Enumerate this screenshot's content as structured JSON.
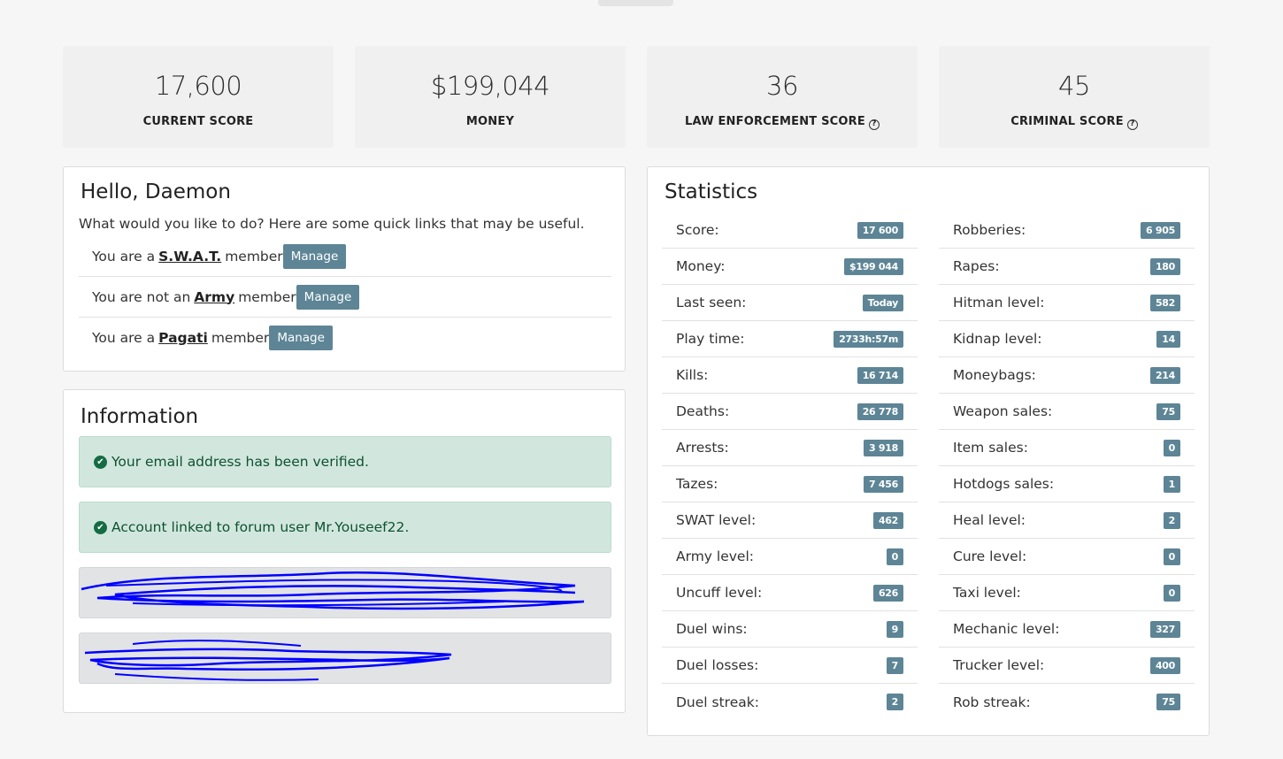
{
  "score_cards": [
    {
      "value": "17,600",
      "label": "CURRENT SCORE",
      "help": false
    },
    {
      "value": "$199,044",
      "label": "MONEY",
      "help": false
    },
    {
      "value": "36",
      "label": "LAW ENFORCEMENT SCORE",
      "help": true
    },
    {
      "value": "45",
      "label": "CRIMINAL SCORE",
      "help": true
    }
  ],
  "hello": {
    "title": "Hello, Daemon",
    "intro": "What would you like to do? Here are some quick links that may be useful.",
    "memberships": [
      {
        "prefix": "You are a",
        "group": "S.W.A.T.",
        "suffix": "member",
        "button": "Manage"
      },
      {
        "prefix": "You are not an",
        "group": "Army",
        "suffix": "member",
        "button": "Manage"
      },
      {
        "prefix": "You are a",
        "group": "Pagati",
        "suffix": "member",
        "button": "Manage"
      }
    ]
  },
  "information": {
    "title": "Information",
    "alerts": [
      {
        "text": "Your email address has been verified.",
        "type": "success"
      },
      {
        "text": "Account linked to forum user Mr.Youseef22.",
        "type": "success"
      }
    ]
  },
  "statistics": {
    "title": "Statistics",
    "left": [
      {
        "label": "Score:",
        "value": "17 600"
      },
      {
        "label": "Money:",
        "value": "$199 044"
      },
      {
        "label": "Last seen:",
        "value": "Today"
      },
      {
        "label": "Play time:",
        "value": "2733h:57m"
      },
      {
        "label": "Kills:",
        "value": "16 714"
      },
      {
        "label": "Deaths:",
        "value": "26 778"
      },
      {
        "label": "Arrests:",
        "value": "3 918"
      },
      {
        "label": "Tazes:",
        "value": "7 456"
      },
      {
        "label": "SWAT level:",
        "value": "462"
      },
      {
        "label": "Army level:",
        "value": "0"
      },
      {
        "label": "Uncuff level:",
        "value": "626"
      },
      {
        "label": "Duel wins:",
        "value": "9"
      },
      {
        "label": "Duel losses:",
        "value": "7"
      },
      {
        "label": "Duel streak:",
        "value": "2"
      }
    ],
    "right": [
      {
        "label": "Robberies:",
        "value": "6 905"
      },
      {
        "label": "Rapes:",
        "value": "180"
      },
      {
        "label": "Hitman level:",
        "value": "582"
      },
      {
        "label": "Kidnap level:",
        "value": "14"
      },
      {
        "label": "Moneybags:",
        "value": "214"
      },
      {
        "label": "Weapon sales:",
        "value": "75"
      },
      {
        "label": "Item sales:",
        "value": "0"
      },
      {
        "label": "Hotdogs sales:",
        "value": "1"
      },
      {
        "label": "Heal level:",
        "value": "2"
      },
      {
        "label": "Cure level:",
        "value": "0"
      },
      {
        "label": "Taxi level:",
        "value": "0"
      },
      {
        "label": "Mechanic level:",
        "value": "327"
      },
      {
        "label": "Trucker level:",
        "value": "400"
      },
      {
        "label": "Rob streak:",
        "value": "75"
      }
    ]
  },
  "colors": {
    "badge": "#5d8596",
    "manage_button": "#5d8596",
    "success_bg": "#d1e7dd",
    "scribble": "#0000ff"
  }
}
